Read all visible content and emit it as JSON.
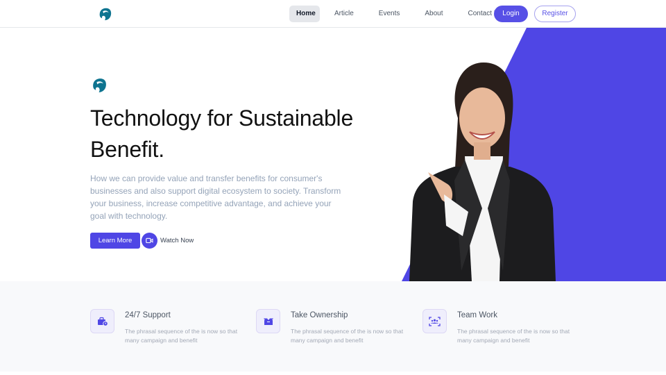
{
  "nav": {
    "logo_icon": "brand-wave-logo",
    "links": [
      {
        "label": "Home",
        "active": true
      },
      {
        "label": "Article",
        "active": false
      },
      {
        "label": "Events",
        "active": false
      },
      {
        "label": "About",
        "active": false
      },
      {
        "label": "Contact Us",
        "active": false
      }
    ],
    "login_label": "Login",
    "register_label": "Register"
  },
  "hero": {
    "logo_icon": "brand-wave-logo",
    "title": "Technology for Sustainable Benefit.",
    "description": "How we can provide value and transfer benefits for consumer's businesses and also support digital ecosystem to society. Transform your business, increase competitive advantage, and achieve your goal with technology.",
    "learn_more_label": "Learn More",
    "watch_icon": "video-camera-icon",
    "watch_label": "Watch Now",
    "image_alt": "smiling businesswoman pointing",
    "accent_color": "#4f46e5"
  },
  "features": [
    {
      "icon": "briefcase-clock-icon",
      "title": "24/7 Support",
      "description": "The phrasal sequence of the is now so that many campaign and benefit"
    },
    {
      "icon": "box-open-icon",
      "title": "Take Ownership",
      "description": "The phrasal sequence of the is now so that many campaign and benefit"
    },
    {
      "icon": "team-scan-icon",
      "title": "Team Work",
      "description": "The phrasal sequence of the is now so that many campaign and benefit"
    }
  ]
}
